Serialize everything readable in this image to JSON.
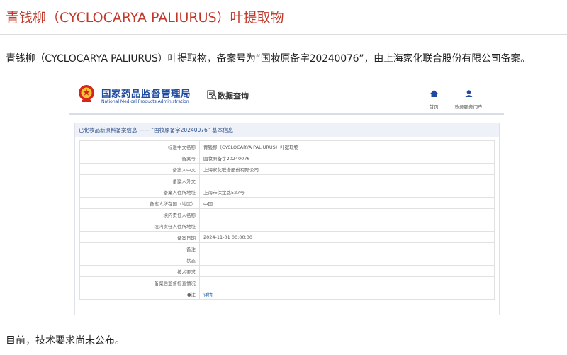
{
  "article": {
    "title": "青钱柳（CYCLOCARYA PALIURUS）叶提取物",
    "intro": "青钱柳（CYCLOCARYA PALIURUS）叶提取物，备案号为“国妆原备字20240076”，由上海家化联合股份有限公司备案。",
    "outro": "目前，技术要求尚未公布。"
  },
  "screenshot": {
    "site": {
      "name": "国家药品监督管理局",
      "name_en": "National Medical Products Administration",
      "emblem_icon": "national-emblem-icon",
      "database_label": "数据查询",
      "nav": [
        {
          "label": "首页",
          "icon": "home-icon"
        },
        {
          "label": "政务服务门户",
          "icon": "user-icon"
        }
      ]
    },
    "panel_title": "已化妆品新原料备案信息 —— “国妆原备字20240076” 基本信息",
    "rows": [
      {
        "label": "标准中文名称",
        "value": "青钱柳（CYCLOCARYA PALIURUS）叶提取物"
      },
      {
        "label": "备案号",
        "value": "国妆原备字20240076"
      },
      {
        "label": "备案人中文",
        "value": "上海家化联合股份有限公司"
      },
      {
        "label": "备案人外文",
        "value": ""
      },
      {
        "label": "备案人住所地址",
        "value": "上海市保定路527号"
      },
      {
        "label": "备案人所在国（地区）",
        "value": "中国"
      },
      {
        "label": "境内责任人名称",
        "value": ""
      },
      {
        "label": "境内责任人住所地址",
        "value": ""
      },
      {
        "label": "备案日期",
        "value": "2024-11-01 00:00:00"
      },
      {
        "label": "备注",
        "value": ""
      },
      {
        "label": "状态",
        "value": ""
      },
      {
        "label": "技术要求",
        "value": ""
      },
      {
        "label": "备案后监督检查情况",
        "value": ""
      },
      {
        "label": "●注",
        "value": "详情"
      }
    ],
    "colors": {
      "brand_blue": "#1e4aa0",
      "title_red": "#c0392b",
      "link_blue": "#2f6db5"
    }
  }
}
